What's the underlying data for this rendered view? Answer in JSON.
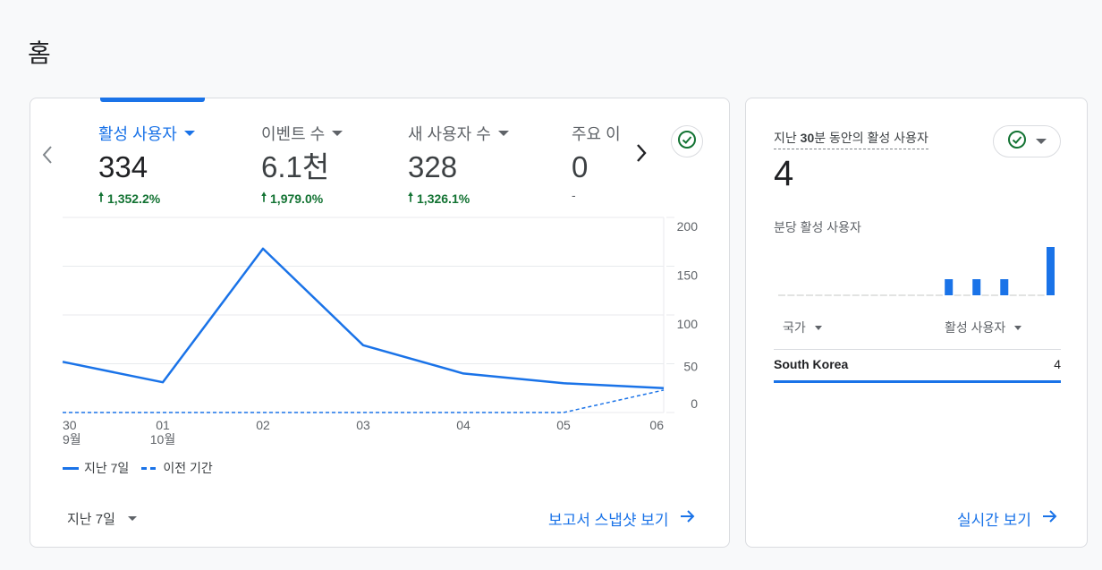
{
  "page": {
    "title": "홈"
  },
  "main_card": {
    "metrics": [
      {
        "label": "활성 사용자",
        "value": "334",
        "delta": "1,352.2%",
        "active": true
      },
      {
        "label": "이벤트 수",
        "value": "6.1천",
        "delta": "1,979.0%"
      },
      {
        "label": "새 사용자 수",
        "value": "328",
        "delta": "1,326.1%"
      },
      {
        "label": "주요 이",
        "value": "0",
        "delta": "-"
      }
    ],
    "nav": {
      "prev": "‹",
      "next": "›"
    },
    "legend": {
      "current": "지난 7일",
      "previous": "이전 기간"
    },
    "period_select": "지난 7일",
    "snapshot_link": "보고서 스냅샷 보기",
    "icons": {
      "prev": "chevron-left-icon",
      "next": "chevron-right-icon",
      "status": "check-circle-icon",
      "link": "arrow-right-icon"
    },
    "colors": {
      "accent": "#1a73e8",
      "positive": "#137333"
    }
  },
  "chart_data": {
    "type": "line",
    "x": [
      "30",
      "01",
      "02",
      "03",
      "04",
      "05",
      "06"
    ],
    "x_sublabels": [
      "9월",
      "10월",
      "",
      "",
      "",
      "",
      ""
    ],
    "series": [
      {
        "name": "지난 7일",
        "values": [
          52,
          31,
          168,
          69,
          40,
          30,
          25
        ],
        "style": "solid"
      },
      {
        "name": "이전 기간",
        "values": [
          0,
          0,
          0,
          0,
          0,
          0,
          23
        ],
        "style": "dashed"
      }
    ],
    "y_ticks": [
      "200",
      "150",
      "100",
      "50",
      "0"
    ],
    "ylim": [
      0,
      200
    ],
    "y_axis_position": "right",
    "grid": true,
    "legend_position": "bottom-left"
  },
  "realtime_card": {
    "title_pre": "지난 ",
    "title_bold": "30",
    "title_post": "분 동안의 활성 사용자",
    "value": "4",
    "subtitle": "분당 활성 사용자",
    "per_minute": [
      0,
      0,
      0,
      0,
      0,
      0,
      0,
      0,
      0,
      0,
      0,
      0,
      0,
      0,
      0,
      0,
      0,
      0,
      1,
      0,
      0,
      1,
      0,
      0,
      1,
      0,
      0,
      0,
      0,
      3
    ],
    "columns": {
      "country": "국가",
      "active_users": "활성 사용자"
    },
    "rows": [
      {
        "country": "South Korea",
        "value": "4",
        "share": 1.0
      }
    ],
    "realtime_link": "실시간 보기"
  }
}
